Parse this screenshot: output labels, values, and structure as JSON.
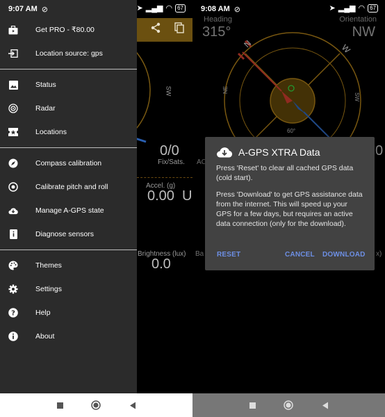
{
  "left_screen": {
    "status_time": "9:07 AM",
    "battery": "67",
    "drawer": {
      "group1": [
        {
          "label": "Get PRO - ₹80.00",
          "icon": "briefcase-icon"
        },
        {
          "label": "Location source: gps",
          "icon": "login-arrow-icon"
        }
      ],
      "group2": [
        {
          "label": "Status",
          "icon": "image-icon"
        },
        {
          "label": "Radar",
          "icon": "radar-icon"
        },
        {
          "label": "Locations",
          "icon": "star-ticket-icon"
        }
      ],
      "group3": [
        {
          "label": "Compass calibration",
          "icon": "compass-icon"
        },
        {
          "label": "Calibrate pitch and roll",
          "icon": "target-icon"
        },
        {
          "label": "Manage A-GPS state",
          "icon": "cloud-download-icon"
        },
        {
          "label": "Diagnose sensors",
          "icon": "device-info-icon"
        }
      ],
      "group4": [
        {
          "label": "Themes",
          "icon": "palette-icon"
        },
        {
          "label": "Settings",
          "icon": "gear-icon"
        },
        {
          "label": "Help",
          "icon": "help-icon"
        },
        {
          "label": "About",
          "icon": "info-icon"
        }
      ]
    },
    "underlay": {
      "sats_value": "0/0",
      "sats_label": "Fix/Sats.",
      "accel_label": "Accel. (g)",
      "accel_value": "0.00",
      "u_fragment": "U",
      "brightness_label": "Brightness (lux)",
      "brightness_value": "0.0",
      "sw_label": "SW"
    }
  },
  "right_screen": {
    "status_time": "9:08 AM",
    "battery": "67",
    "heading_label": "Heading",
    "heading_value": "315°",
    "orientation_label": "Orientation",
    "orientation_value": "NW",
    "compass_labels": {
      "n": "N",
      "w": "W",
      "ne": "NE",
      "sw": "SW",
      "deg": "60°"
    },
    "dialog": {
      "title": "A-GPS XTRA Data",
      "para1": "Press 'Reset' to clear all cached GPS data (cold start).",
      "para2": "Press 'Download' to get GPS assistance data from the internet. This will speed up your GPS for a few days, but requires an active data connection (only for the download).",
      "reset": "RESET",
      "cancel": "CANCEL",
      "download": "DOWNLOAD"
    },
    "bg_fragments": {
      "left_a": "AC",
      "left_b": "Ba",
      "right_x": "x)",
      "right_0": "0"
    }
  },
  "colors": {
    "accent": "#6d8fe4",
    "compass_gold": "#b8861b",
    "drawer_bg": "#2b2b2b",
    "dialog_bg": "#424242"
  }
}
